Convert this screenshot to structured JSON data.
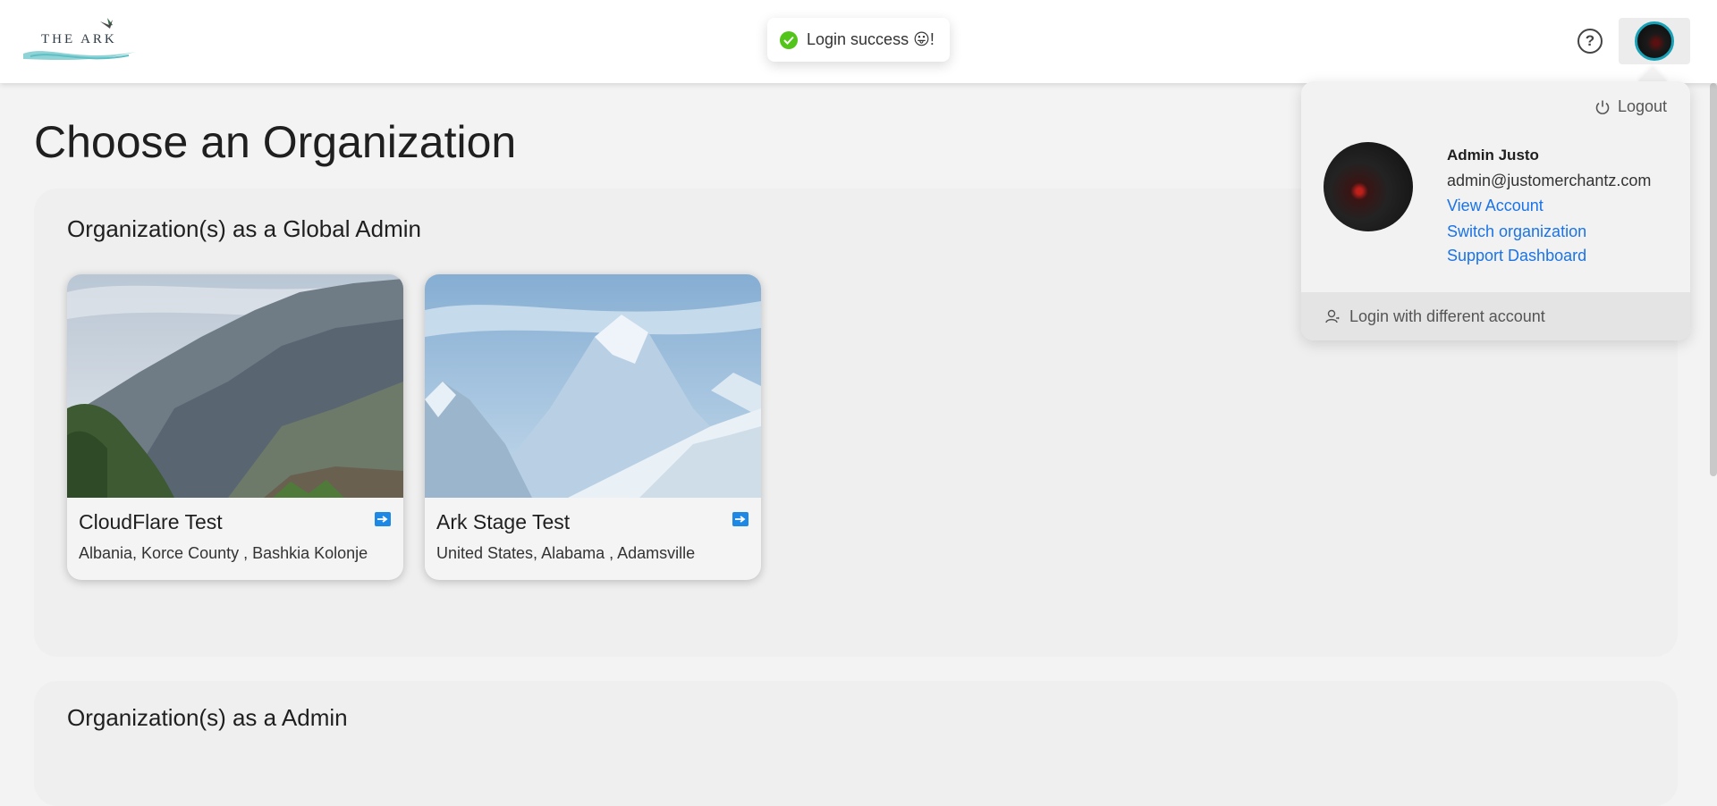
{
  "header": {
    "logo_text": "THE ARK",
    "toast_text": "Login success 😛!",
    "help_symbol": "?"
  },
  "page": {
    "title": "Choose an Organization"
  },
  "sections": [
    {
      "title": "Organization(s) as a Global Admin",
      "cards": [
        {
          "name": "CloudFlare Test",
          "location": "Albania, Korce County , Bashkia Kolonje",
          "image": "mountain-valley-photo"
        },
        {
          "name": "Ark Stage Test",
          "location": "United States, Alabama , Adamsville",
          "image": "snowy-mountain-render"
        }
      ]
    },
    {
      "title": "Organization(s) as a Admin"
    }
  ],
  "account_menu": {
    "logout_label": "Logout",
    "name": "Admin Justo",
    "email": "admin@justomerchantz.com",
    "links": [
      "View Account",
      "Switch organization",
      "Support Dashboard"
    ],
    "alt_login_label": "Login with different account"
  },
  "colors": {
    "link": "#1a73e8",
    "success": "#52c41a",
    "avatar_ring": "#17a2b8",
    "enter_icon": "#1e88e5"
  },
  "icons": {
    "toast": "check-circle-icon",
    "help": "question-circle-icon",
    "logout": "power-icon",
    "alt_login": "user-switch-icon",
    "card_enter": "arrow-right-square-icon"
  }
}
